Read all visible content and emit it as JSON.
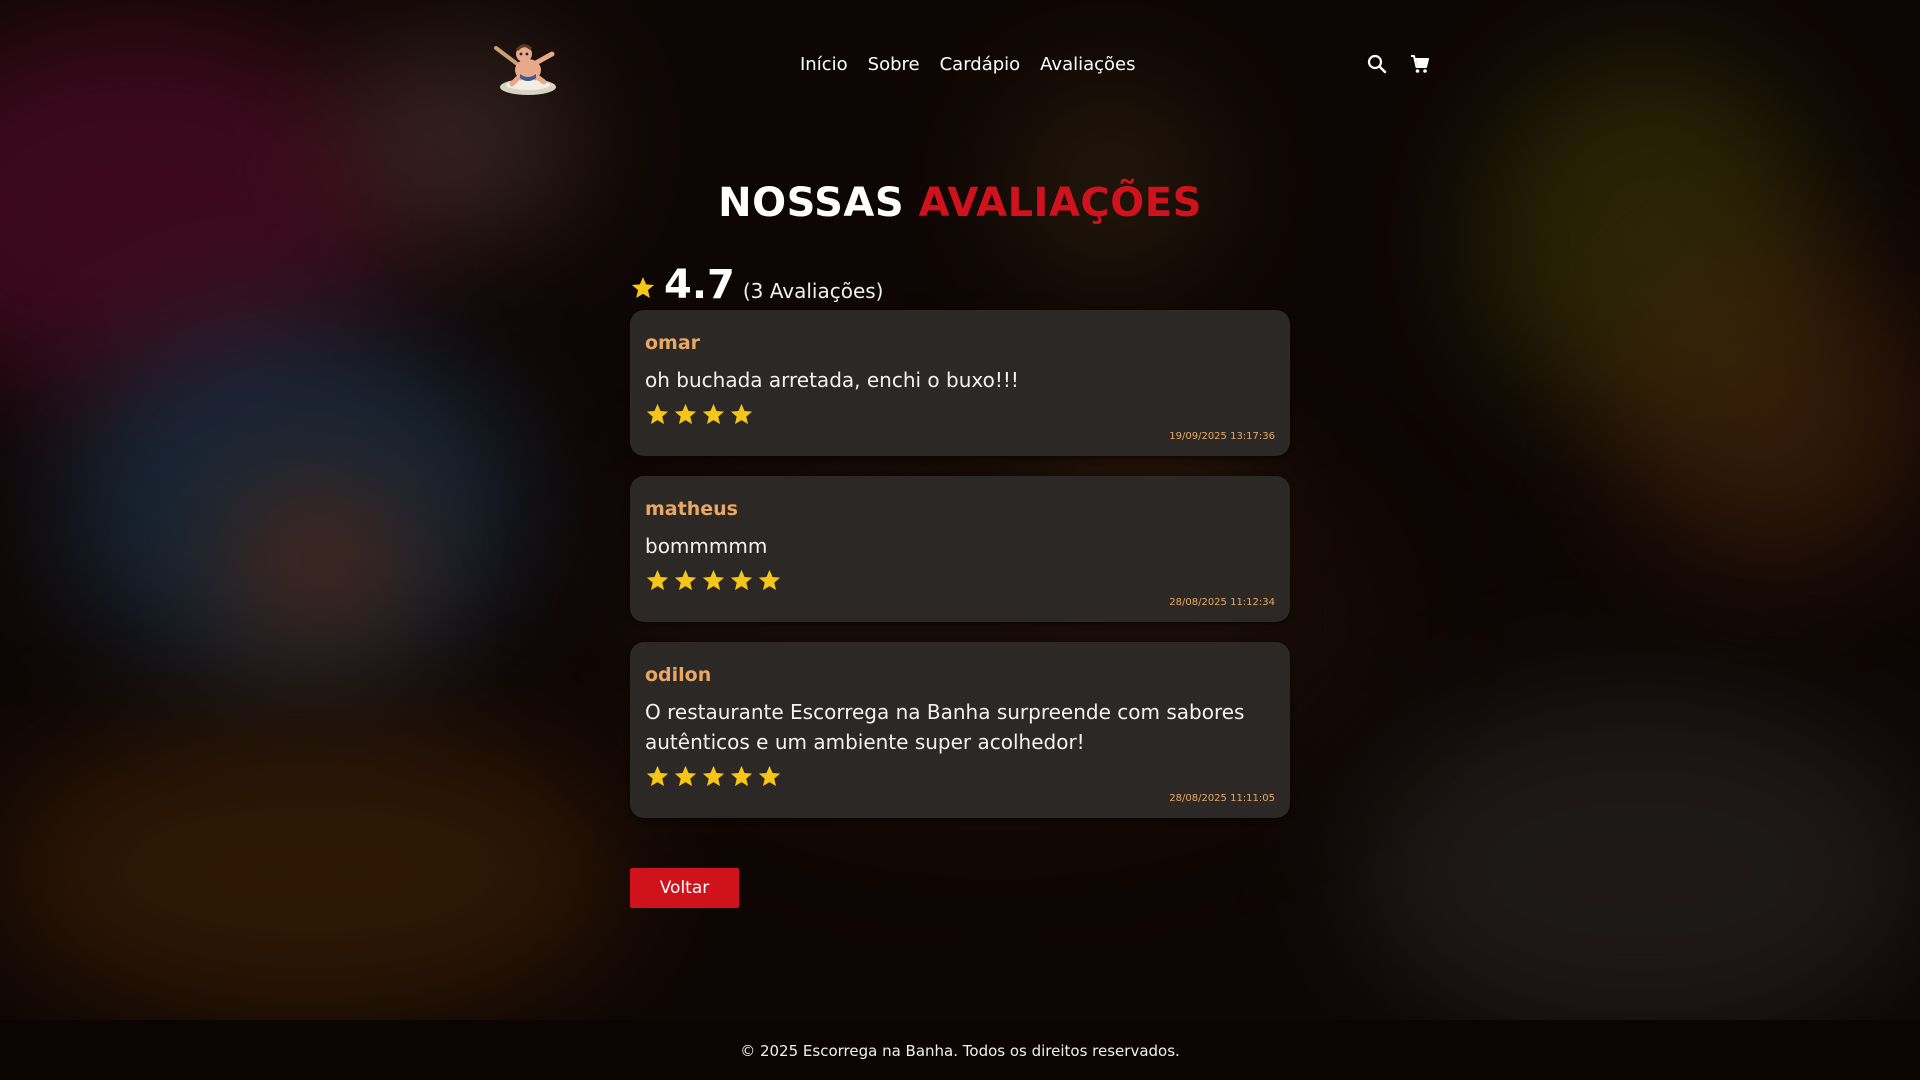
{
  "nav": {
    "items": [
      "Início",
      "Sobre",
      "Cardápio",
      "Avaliações"
    ]
  },
  "header_icons": [
    "search-icon",
    "cart-icon"
  ],
  "page": {
    "title_main": "NOSSAS",
    "title_accent": "AVALIAÇÕES"
  },
  "summary": {
    "average": "4.7",
    "count_text": "(3 Avaliações)"
  },
  "reviews": [
    {
      "author": "omar",
      "text": "oh buchada arretada, enchi o buxo!!!",
      "rating": 4,
      "date": "19/09/2025 13:17:36"
    },
    {
      "author": "matheus",
      "text": "bommmmm",
      "rating": 5,
      "date": "28/08/2025 11:12:34"
    },
    {
      "author": "odilon",
      "text": "O restaurante Escorrega na Banha surpreende com sabores autênticos e um ambiente super acolhedor!",
      "rating": 5,
      "date": "28/08/2025 11:11:05"
    }
  ],
  "back_button": {
    "label": "Voltar"
  },
  "footer": {
    "text": "© 2025 Escorrega na Banha. Todos os direitos reservados."
  },
  "colors": {
    "accent_red": "#d0121c",
    "author_orange": "#e8a765",
    "star_yellow": "#f5c518",
    "card_bg": "#2b2826"
  }
}
